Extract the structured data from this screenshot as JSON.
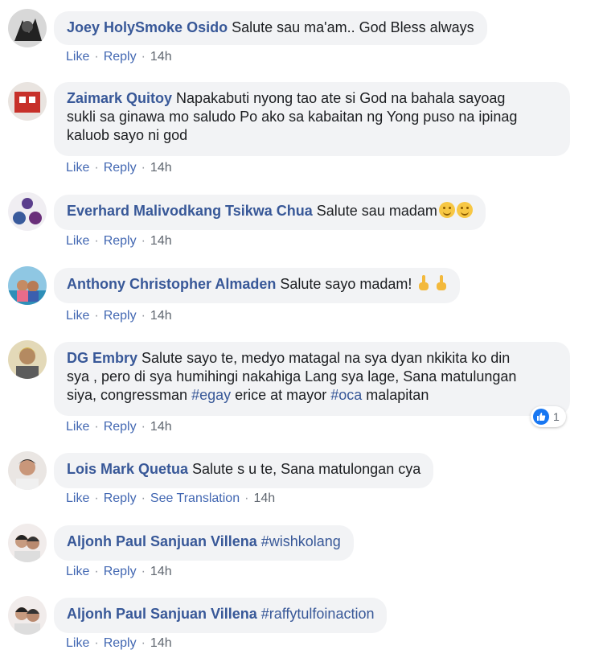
{
  "actions": {
    "like": "Like",
    "reply": "Reply",
    "see_translation": "See Translation",
    "separator": "·"
  },
  "colors": {
    "author": "#385898",
    "action_link": "#4267b2",
    "bubble_bg": "#f2f3f5",
    "text": "#1c1e21",
    "meta": "#606770",
    "like_blue": "#1877f2"
  },
  "comments": [
    {
      "author": "Joey HolySmoke Osido",
      "text": "Salute sau ma'am.. God Bless always",
      "time": "14h"
    },
    {
      "author": "Zaimark Quitoy",
      "text_lines": [
        "Napakabuti nyong tao ate si God na bahala sayoag",
        "sukli sa ginawa mo saludo Po ako sa kabaitan ng Yong puso na ipinag",
        "kaluob sayo ni god"
      ],
      "time": "14h"
    },
    {
      "author": "Everhard Malivodkang Tsikwa Chua",
      "text": "Salute sau madam",
      "emoji": "smiling-face-emoji",
      "time": "14h"
    },
    {
      "author": "Anthony Christopher Almaden",
      "text": "Salute sayo madam!",
      "emoji": "pointing-up-emoji",
      "time": "14h"
    },
    {
      "author": "DG Embry",
      "text_lines": [
        "Salute sayo te, medyo matagal na sya dyan nkikita ko din",
        "sya , pero di sya humihingi nakahiga Lang sya lage, Sana matulungan",
        "siya, congressman"
      ],
      "hashtag1": "#egay",
      "mid_text": "erice at mayor",
      "hashtag2": "#oca",
      "end_text": "malapitan",
      "reaction_count": "1",
      "time": "14h"
    },
    {
      "author": "Lois Mark Quetua",
      "text": "Salute s u te, Sana matulongan cya",
      "time": "14h"
    },
    {
      "author": "Aljonh Paul Sanjuan Villena",
      "hashtag": "#wishkolang",
      "time": "14h"
    },
    {
      "author": "Aljonh Paul Sanjuan Villena",
      "hashtag": "#raffytulfoinaction",
      "time": "14h"
    }
  ]
}
